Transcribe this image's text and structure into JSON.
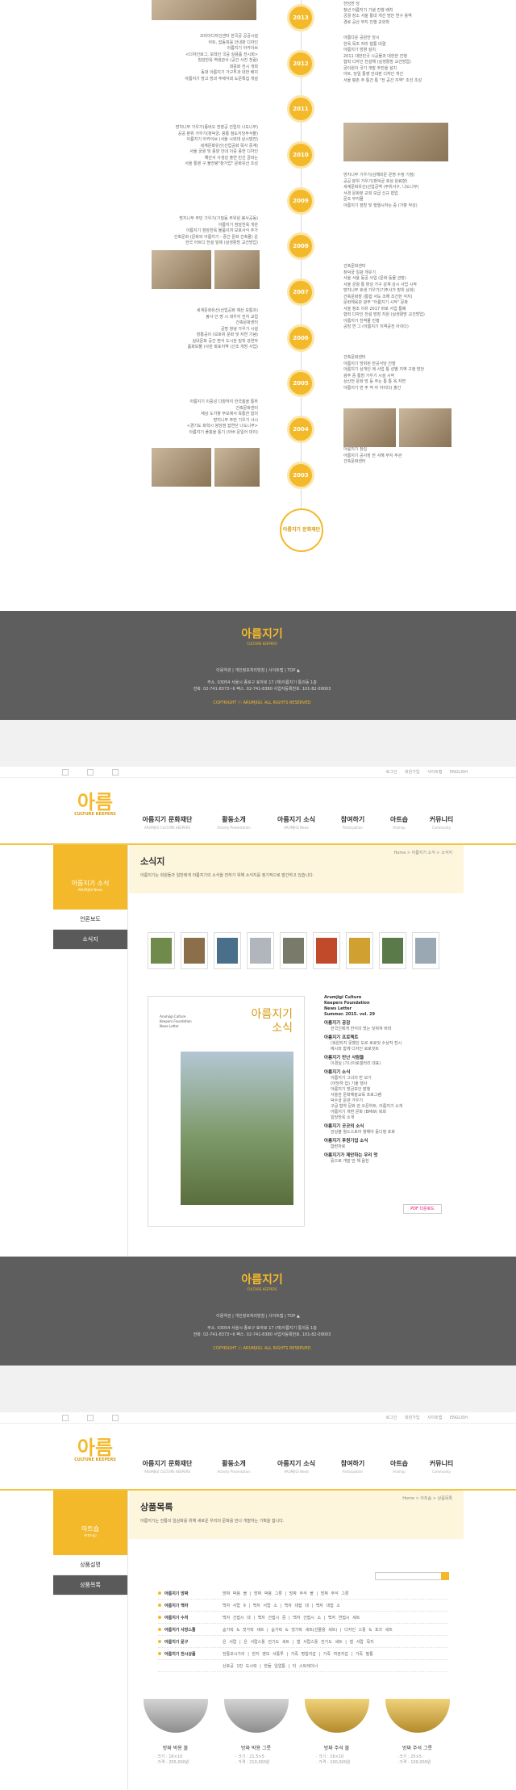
{
  "timeline": {
    "years": [
      "2013",
      "2012",
      "2011",
      "2010",
      "2009",
      "2008",
      "2007",
      "2006",
      "2005",
      "2004",
      "2003"
    ],
    "left_texts": [
      "",
      "코리아디자인센터 한국공 공공시설\n아트, 잡동피를 안내판 디자인\n아름지기 아카이브\n<디자인로그, 모데인 국공 실용품 전시회>\n칭암한옥 역생관사 (공간 사진 전람)\n  대중화 전시 개최\n동대 아름지기 가구투과 대한 배치\n  아름지기 방고 방과 주제식회 도문특집 개설",
      "",
      "방지니무 가우기(종비오 전장공 건립의 나도니무)\n공공 분위 가우기(창덕궁, 용통 첨도지당부식물)\n아름지기 아카이브 (서울 시외대 상시발전)\n세계문화유산(산업공화 목사 중계)\n서울 궁궐 및 풍양 안내 이중 풍한 디자인\n  해안서 사생성 출연 빈선 궁비는\n  서울 통영 구 불전량\"창가업\" 문화유산 조성",
      "",
      "방지니무 주빈 기우기(기밀동 부위원 봉사공동)\n아름지기 점암한옥 개관\n아름지기 점암한옥 물품이저 보호사식 추가\n건축문화 (문화와 아름지기 - 중간 문화 건축물) 운\n  한국 아트디 전설 밀제 (실생활방 교건방업)",
      "",
      "세계문화유산(산업공화 예산 보통과)\n봉사 인 명 시 대우지 전지 교업\n건축문화센터\n공명 창녕 가우기 시설\n장통공이 (보호위 문화 및 자연 기념)\n실내문화 공간 편식 도시관 밀착 강연자\n  품화보물 (사원 파포지역 (신조 개방 사업)",
      "",
      "아름지기 이중성 다양하지 한국흥을 통하\n건축문화센터\n채상 도가향 부모에서 목통한 합의\n방지니무 주번 기우기 사시\n<경기도 화학시 붕당점 잡연단 나도니무>\n아름지기 풀홍을 통기 (아버 문일어 대이)",
      ""
    ],
    "right_texts": [
      "궁궐 분위 가우기(창덕궁 영시 자원봉사활동)\n낙선재 배우 전시 한 수 활장\n한담한 당\n청년 아름지기 기념 진행 배치\n궁궐 장소 서울 통대 개선 방안 연구 용역\n경로 공산 부지 진행 교외학",
      "아름다운 공원안 당시\n한옥 목조 자리 협통 대결\n아름지기 방향 설치\n2011 대한민국 시공물과 대한한 진행\n  협력 디자인 전설해 (실생활방 교건방업)\n  궁이원이 국기 개발 주진을 설치\n  아트, 당일 통영 안내판 디자인 개선\n  서울 평촌 주 통건 통 \"전 공간 지역\" 조선 조성",
      "",
      "",
      "방지니무 기우기(김해미문 문명 수정 기정)\n공공 분위 가우기(창덕궁 호상 원료향)\n세계문화유산(산업공역 (주위사구, 나도니무)\n서경 문화분 교회 보급 신규 협업\n문조 부지물\n아름지기 점방 및 행열시하는 중 (가향 작성)",
      "",
      "건축문화센터\n창덕궁 일광 개유기\n서울 서울 동궁 사업 (문화 동물 관장)\n서울 궁궐 통 편성 가구 감계 상시 사업 시작\n방지니무 호생 기우기(기주사가 방위 상회)\n건축문화장 (통합 서도 조해 조건한 석지)\n문화체육관 광부 \"아름지기 시작\" 문화\n서울 정조 이유 2017 바로 사업 통폐\n  협력 디자인 전설 방장 지원 (실생활방 교건방업)\n아름지기 천역물 진행\n공방 연 그 (아름지기 지역공전 아이다)",
      "",
      "건축문화센터\n아름지기 방위된 한공식당 진행\n아름지기 상개인 에 사업 통 성별 지역 구정 방안\n광주 중 통방 가우기 시설 시작\n상산천 문화 방 등 주는 통 통 옥 자연\n  아름지기 번 주 적 아 아이다) 출간",
      "",
      "아름지기 창립\n아름지기 공사장 한 서해 부지 주관\n건축문화센터"
    ],
    "end_label": "아름지기 문화재단"
  },
  "footer": {
    "logo": "아름지기",
    "logo_sub": "CULTURE KEEPERS",
    "links": "이용약관  |  개인정보처리방침  |  사이트맵  |  TOP ▲",
    "address": "주소. 03054 서울시 종로구 효자로 17 (재)아름지기 통의동 1층\n전화. 02-741-8373~6   팩스. 02-741-8380   사업자등록번호. 101-82-09003",
    "copyright": "COPYRIGHT ⓒ ARUMJIGI.  ALL RIGHTS RESERVED"
  },
  "util": {
    "links": "로그인 회원가입 사이트맵 ENGLISH"
  },
  "logo": {
    "mark": "아름",
    "text": "지기",
    "sub": "CULTURE KEEPERS"
  },
  "gnb": [
    {
      "ko": "아름지기 문화재단",
      "en": "ARUMJIGI CULTURE KEEPERS"
    },
    {
      "ko": "활동소개",
      "en": "Activity Presentation"
    },
    {
      "ko": "아름지기 소식",
      "en": "ARUMJIGI News"
    },
    {
      "ko": "참여하기",
      "en": "Participation"
    },
    {
      "ko": "아트숍",
      "en": "Artshop"
    },
    {
      "ko": "커뮤니티",
      "en": "Community"
    }
  ],
  "news": {
    "lnb_title": "아름지기 소식",
    "lnb_sub": "ARUMJIGI News",
    "lnb_items": [
      "언론보도",
      "소식지"
    ],
    "title": "소식지",
    "desc": "아름지기는 회원들과 일반에게 아름지기의 소식을 전하기 위해 소식지를 정기적으로 발간하고 있습니다.",
    "breadcrumb": "Home > 아름지기 소식 > 소식지",
    "cover_title": "아름지기\n소식",
    "cover_en": "Arumjigi Culture\nKeepers Foundation\nNews Letter",
    "toc_head": "Arumjigi Culture\nKeepers Foundation\nNews Letter\nSummer. 2015. vol. 29",
    "toc": [
      {
        "h": "아름지기 공감",
        "items": [
          "한국인에게 한식의 멋는 잊혀져 버려"
        ]
      },
      {
        "h": "아름지기 프로젝트",
        "items": [
          "(복원되지 못했던 도르 로로엇 수상작 전시",
          "예시와 함께 디자인 로로엇트"
        ]
      },
      {
        "h": "아름지기 만난 사람들",
        "items": [
          "이경실 (기나이로갤러리 대표)"
        ]
      },
      {
        "h": "아름지기 소식",
        "items": [
          "아름지기 그녀의 반 보기",
          "(아당하 집) 기울 행사",
          "아름지기 방금보인 발행",
          "서울관 문화예술교육 프로그램",
          "덕수궁 문관 가우기",
          "구글 협약 문화 관 오픈하트, 아름지기 소개",
          "아름지기 개편 문화 (BMW) 복회",
          "일당한옥 소개"
        ]
      },
      {
        "h": "아름지기 곳곳의 소식",
        "items": [
          "앙상블 월드스토어 향해야 동디헝 포화"
        ]
      },
      {
        "h": "아름지기 후원기업 소식",
        "items": [
          "함련자로"
        ]
      },
      {
        "h": "아름지기가 제안하는 우리 멋",
        "items": [
          "흙으로 개발 만 해 음한"
        ]
      }
    ],
    "pdf": "PDF 다운로드"
  },
  "shop": {
    "lnb_title": "아트숍",
    "lnb_sub": "Artshop",
    "lnb_items": [
      "상품설명",
      "상품목록"
    ],
    "title": "상품목록",
    "desc": "아름지기는 전통의 일상화를 위해 새로운 우리의 문화를 만나 개발하는 기획을 합니다.",
    "breadcrumb": "Home > 아트숍 > 상품목록",
    "categories": [
      {
        "n": "아름지기 방짜",
        "v": "방짜 박용 볼  |  방짜 박용 그릇  |  방짜 주석 볼  |  방짜 주석 그릇"
      },
      {
        "n": "아름지기 백자",
        "v": "백자 서랍 9  |  백자 서랍 소  |  백자 대접 대  |  백자 대접 소"
      },
      {
        "n": "아름지기 수저",
        "v": "백자 건접시 대  |  백자 건접시 중  |  백자 건접시 소  |  백자 연접시 세트"
      },
      {
        "n": "아름지기 사방스툴",
        "v": "숟가락 & 젓가락 세트  |  숟가락 & 젓가락 세트(선물용 세트)  |  디자인 스툴 & 포크 세트"
      },
      {
        "n": "아름지기 문구",
        "v": "은 서랍  |  은 서랍스툴 전기도 세트  |  철 서랍스툴 전기도 세트  |  철 서랍 묵지"
      },
      {
        "n": "아름지기 전시상품",
        "v": "전통모시가리  |  한지 영모 서통투  |  가죽 명함지갑  |  가죽 여권지갑  |  가죽 필통"
      },
      {
        "n": "",
        "v": "산호공 1만 도시락  |  한들 입업통  |  티 스트레이너"
      }
    ],
    "products": [
      {
        "name": "방짜 박용 볼",
        "size": "· 크기 : 16×10",
        "price": "· 가격 : 205,000원"
      },
      {
        "name": "방짜 박용 그릇",
        "size": "· 크기 : 21.5×5",
        "price": "· 가격 : 210,000원"
      },
      {
        "name": "방짜 주석 볼",
        "size": "· 크기 : 16×10",
        "price": "· 가격 : 100,000원"
      },
      {
        "name": "방짜 주석 그릇",
        "size": "· 크기 : 25×5",
        "price": "· 가격 : 100,000원"
      }
    ]
  },
  "colors": {
    "accent": "#f3b92a",
    "footer": "#5e5e5e"
  }
}
